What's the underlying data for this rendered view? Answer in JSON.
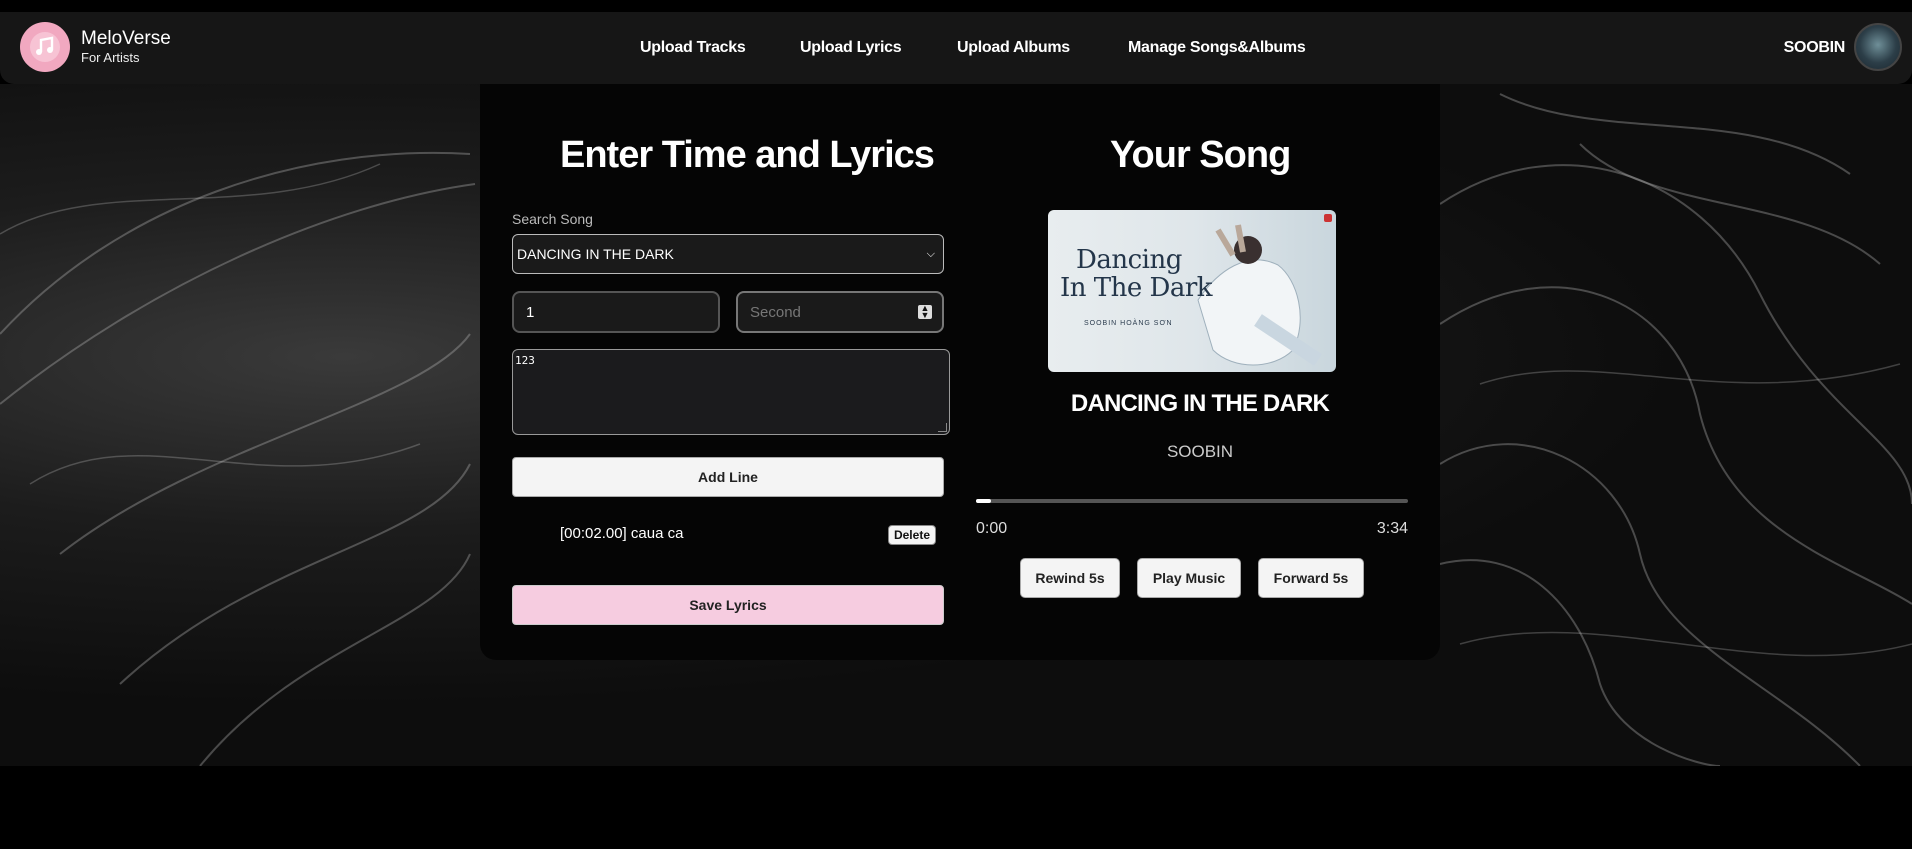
{
  "brand": {
    "name": "MeloVerse",
    "subtitle": "For Artists",
    "accent": "#f1a8c0"
  },
  "nav": {
    "items": [
      {
        "label": "Upload Tracks"
      },
      {
        "label": "Upload Lyrics"
      },
      {
        "label": "Upload Albums"
      },
      {
        "label": "Manage Songs&Albums"
      }
    ]
  },
  "user": {
    "name": "SOOBIN"
  },
  "editor": {
    "title": "Enter Time and Lyrics",
    "search_label": "Search Song",
    "selected_song": "DANCING IN THE DARK",
    "minute_value": "1",
    "second_placeholder": "Second",
    "lyric_text": "123",
    "add_line_label": "Add Line",
    "lines": [
      {
        "text": "[00:02.00] caua ca",
        "delete_label": "Delete"
      }
    ],
    "save_label": "Save Lyrics",
    "save_color": "#f6cce0"
  },
  "player": {
    "title": "Your Song",
    "cover": {
      "title_line1": "Dancing",
      "title_line2": "In The Dark",
      "artist_text": "SOOBIN HOÀNG SƠN"
    },
    "song_title": "DANCING IN THE DARK",
    "artist": "SOOBIN",
    "progress": 0.0,
    "current_time": "0:00",
    "duration": "3:34",
    "controls": {
      "rewind": "Rewind 5s",
      "play": "Play Music",
      "forward": "Forward 5s"
    }
  }
}
